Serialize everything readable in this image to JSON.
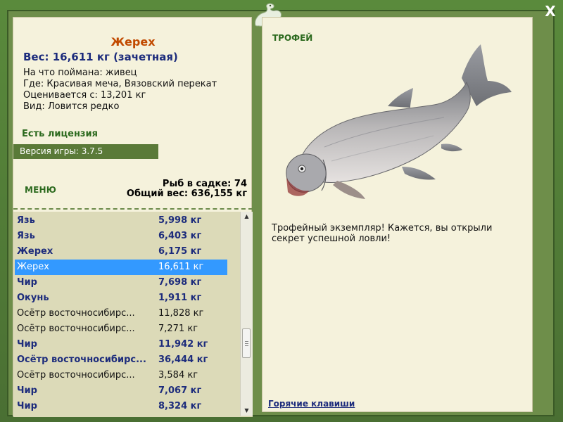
{
  "window": {
    "close_label": "X"
  },
  "info": {
    "fish_name": "Жерех",
    "weight": "Вес: 16,611 кг (зачетная)",
    "bait": "На что поймана: живец",
    "location": "Где: Красивая меча, Вязовский перекат",
    "estimated": "Оценивается с: 13,201 кг",
    "type": "Вид: Ловится редко",
    "license": "Есть лицензия",
    "version": "Версия игры: 3.7.5"
  },
  "menu": {
    "label": "МЕНЮ"
  },
  "stats": {
    "catch_count": "Рыб в садке: 74",
    "total_weight": "Общий вес: 636,155 кг"
  },
  "catch_list": [
    {
      "name": "Язь",
      "weight": "5,998 кг",
      "style": "bold"
    },
    {
      "name": "Язь",
      "weight": "6,403 кг",
      "style": "bold"
    },
    {
      "name": "Жерех",
      "weight": "6,175 кг",
      "style": "bold"
    },
    {
      "name": "Жерех",
      "weight": "16,611 кг",
      "style": "selected"
    },
    {
      "name": "Чир",
      "weight": "7,698 кг",
      "style": "bold"
    },
    {
      "name": "Окунь",
      "weight": "1,911 кг",
      "style": "bold"
    },
    {
      "name": "Осётр восточносибирс...",
      "weight": "11,828 кг",
      "style": "normal"
    },
    {
      "name": "Осётр восточносибирс...",
      "weight": "7,271 кг",
      "style": "normal"
    },
    {
      "name": "Чир",
      "weight": "11,942 кг",
      "style": "bold"
    },
    {
      "name": "Осётр восточносибирс...",
      "weight": "36,444 кг",
      "style": "bold"
    },
    {
      "name": "Осётр восточносибирс...",
      "weight": "3,584 кг",
      "style": "normal"
    },
    {
      "name": "Чир",
      "weight": "7,067 кг",
      "style": "bold"
    },
    {
      "name": "Чир",
      "weight": "8,324 кг",
      "style": "bold"
    }
  ],
  "trophy": {
    "title": "ТРОФЕЙ",
    "text": "Трофейный экземпляр! Кажется, вы открыли секрет успешной ловли!",
    "hotkeys": "Горячие клавиши"
  },
  "colors": {
    "frame_green": "#4c7434",
    "panel_bg": "#f5f2dc",
    "selection_blue": "#3399ff",
    "fish_name_orange": "#c14a00",
    "text_navy": "#1d2c7c",
    "label_green": "#2c6a1e"
  }
}
